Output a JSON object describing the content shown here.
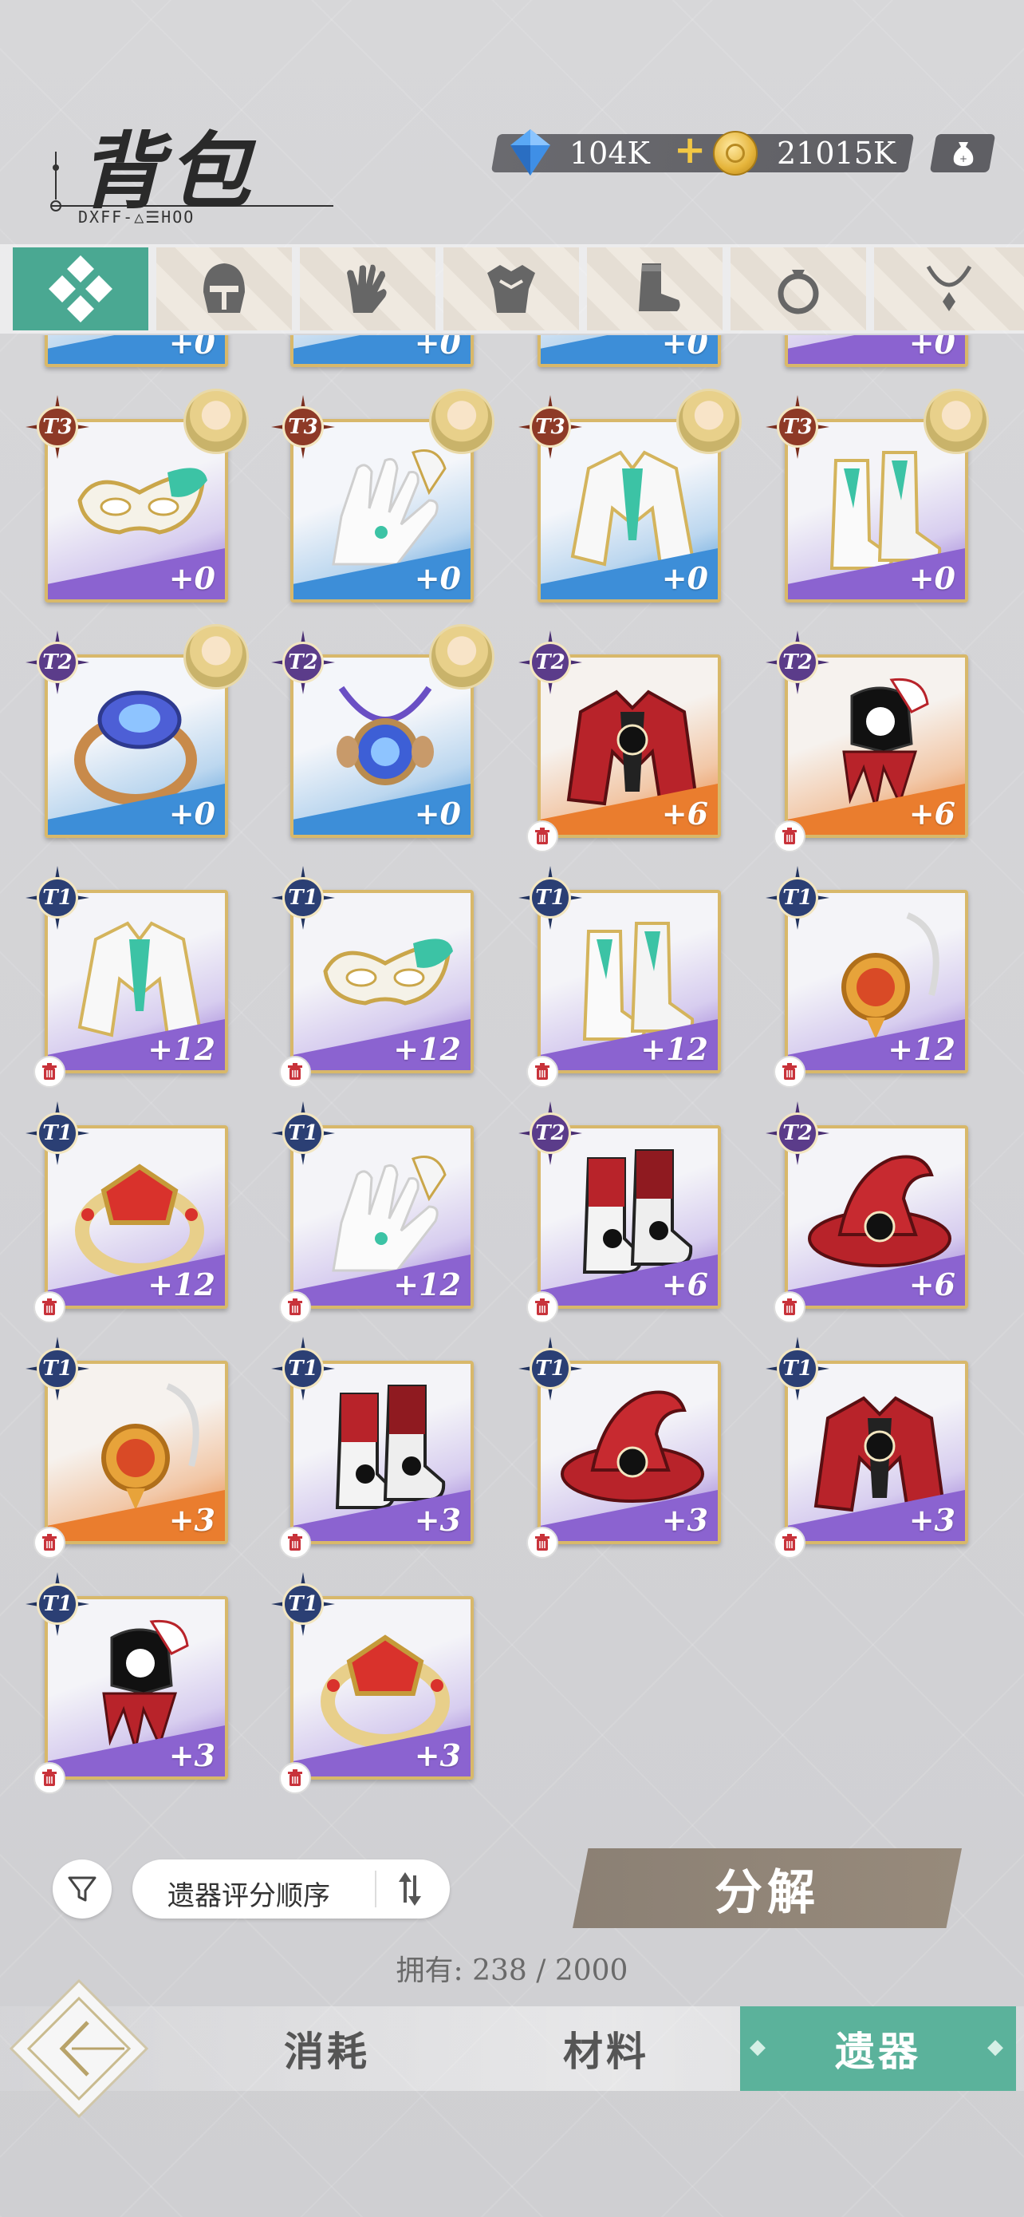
{
  "header": {
    "title": "背包",
    "subtitle_code": "DXFF-△☰HOO",
    "gems": "104K",
    "gold": "21015K",
    "plus": "+"
  },
  "categories": [
    {
      "name": "all",
      "icon": "diamond-grid-icon"
    },
    {
      "name": "helmet",
      "icon": "helmet-icon"
    },
    {
      "name": "gloves",
      "icon": "glove-icon"
    },
    {
      "name": "armor",
      "icon": "armor-icon"
    },
    {
      "name": "boots",
      "icon": "boot-icon"
    },
    {
      "name": "ring",
      "icon": "ring-icon"
    },
    {
      "name": "necklace",
      "icon": "necklace-icon"
    }
  ],
  "items": [
    {
      "tier": "",
      "level": "+0",
      "color": "blue",
      "kind": "partial"
    },
    {
      "tier": "",
      "level": "+0",
      "color": "blue",
      "kind": "partial"
    },
    {
      "tier": "",
      "level": "+0",
      "color": "blue",
      "kind": "partial"
    },
    {
      "tier": "",
      "level": "+0",
      "color": "purple",
      "kind": "partial"
    },
    {
      "tier": "T3",
      "level": "+0",
      "color": "purple",
      "kind": "mask",
      "avatar": true
    },
    {
      "tier": "T3",
      "level": "+0",
      "color": "blue",
      "kind": "glove",
      "avatar": true
    },
    {
      "tier": "T3",
      "level": "+0",
      "color": "blue",
      "kind": "coat",
      "avatar": true
    },
    {
      "tier": "T3",
      "level": "+0",
      "color": "purple",
      "kind": "boots",
      "avatar": true
    },
    {
      "tier": "T2",
      "level": "+0",
      "color": "blue",
      "kind": "ring",
      "avatar": true
    },
    {
      "tier": "T2",
      "level": "+0",
      "color": "blue",
      "kind": "amulet",
      "avatar": true
    },
    {
      "tier": "T2",
      "level": "+6",
      "color": "orange",
      "kind": "redcoat",
      "trash": true
    },
    {
      "tier": "T2",
      "level": "+6",
      "color": "orange",
      "kind": "redglove",
      "trash": true
    },
    {
      "tier": "T1",
      "level": "+12",
      "color": "purple",
      "kind": "coat",
      "trash": true
    },
    {
      "tier": "T1",
      "level": "+12",
      "color": "purple",
      "kind": "mask",
      "trash": true
    },
    {
      "tier": "T1",
      "level": "+12",
      "color": "purple",
      "kind": "boots",
      "trash": true
    },
    {
      "tier": "T1",
      "level": "+12",
      "color": "purple",
      "kind": "pendant",
      "trash": true
    },
    {
      "tier": "T1",
      "level": "+12",
      "color": "purple",
      "kind": "goldring",
      "trash": true
    },
    {
      "tier": "T1",
      "level": "+12",
      "color": "purple",
      "kind": "glove",
      "trash": true
    },
    {
      "tier": "T2",
      "level": "+6",
      "color": "purple",
      "kind": "redboots",
      "trash": true
    },
    {
      "tier": "T2",
      "level": "+6",
      "color": "purple",
      "kind": "redhat",
      "trash": true
    },
    {
      "tier": "T1",
      "level": "+3",
      "color": "orange",
      "kind": "pendant",
      "trash": true
    },
    {
      "tier": "T1",
      "level": "+3",
      "color": "purple",
      "kind": "redboots",
      "trash": true
    },
    {
      "tier": "T1",
      "level": "+3",
      "color": "purple",
      "kind": "redhat",
      "trash": true
    },
    {
      "tier": "T1",
      "level": "+3",
      "color": "purple",
      "kind": "redcoat",
      "trash": true
    },
    {
      "tier": "T1",
      "level": "+3",
      "color": "purple",
      "kind": "redglove",
      "trash": true
    },
    {
      "tier": "T1",
      "level": "+3",
      "color": "purple",
      "kind": "goldring",
      "trash": true
    }
  ],
  "controls": {
    "sort_label": "遗器评分顺序",
    "decompose_label": "分解",
    "count_text": "拥有: 238 / 2000"
  },
  "bottom_tabs": {
    "consume": "消耗",
    "materials": "材料",
    "relics": "遗器"
  },
  "colors": {
    "accent": "#4aa892",
    "blue_band": "#3d8ed8",
    "purple_band": "#8b63d0",
    "orange_band": "#ea7d2e"
  }
}
